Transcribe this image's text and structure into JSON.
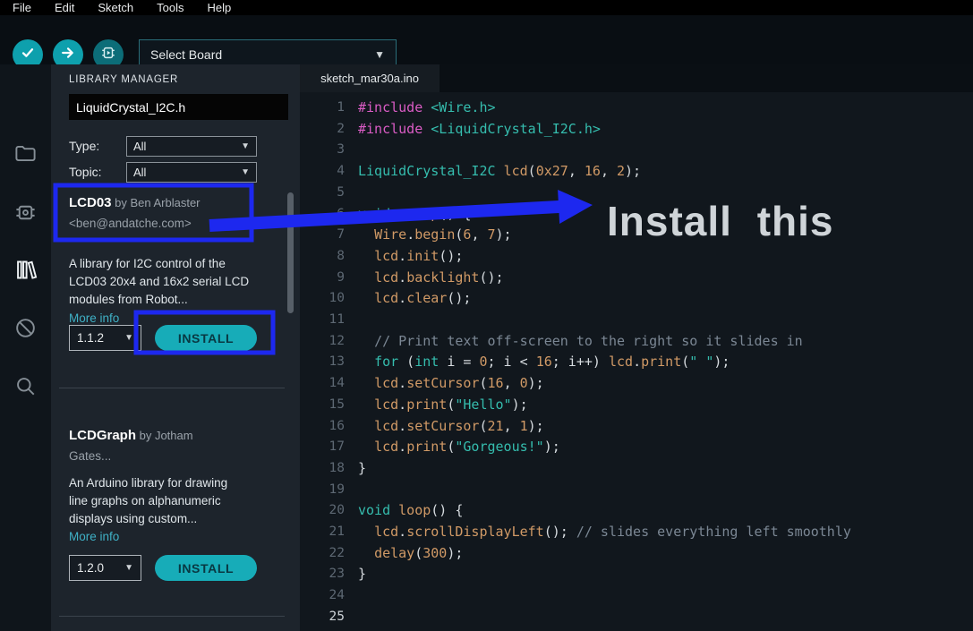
{
  "menu": {
    "items": [
      "File",
      "Edit",
      "Sketch",
      "Tools",
      "Help"
    ]
  },
  "toolbar": {
    "board_selector": "Select Board"
  },
  "activity": {
    "icons": [
      "sketchbook-folder",
      "boards-manager",
      "library-manager",
      "debug",
      "search"
    ]
  },
  "library_manager": {
    "title": "LIBRARY MANAGER",
    "search_value": "LiquidCrystal_I2C.h",
    "type_label": "Type:",
    "type_value": "All",
    "topic_label": "Topic:",
    "topic_value": "All",
    "items": [
      {
        "name": "LCD03",
        "by": " by Ben Arblaster",
        "author_line2": "<ben@andatche.com>",
        "description": [
          "A library for I2C control of the",
          "LCD03 20x4 and 16x2 serial LCD",
          "modules from Robot..."
        ],
        "more_info": "More info",
        "version": "1.1.2",
        "install_label": "INSTALL"
      },
      {
        "name": "LCDGraph",
        "by": " by Jotham",
        "author_line2": "Gates...",
        "description": [
          "An Arduino library for drawing",
          "line graphs on alphanumeric",
          "displays using custom..."
        ],
        "more_info": "More info",
        "version": "1.2.0",
        "install_label": "INSTALL"
      }
    ]
  },
  "editor": {
    "tab": "sketch_mar30a.ino",
    "active_line": 25,
    "lines": [
      [
        [
          "pre",
          "#include"
        ],
        [
          "pln",
          " "
        ],
        [
          "inc",
          "<Wire.h>"
        ]
      ],
      [
        [
          "pre",
          "#include"
        ],
        [
          "pln",
          " "
        ],
        [
          "inc",
          "<LiquidCrystal_I2C.h>"
        ]
      ],
      [],
      [
        [
          "typ",
          "LiquidCrystal_I2C"
        ],
        [
          "pln",
          " "
        ],
        [
          "id",
          "lcd"
        ],
        [
          "pln",
          "("
        ],
        [
          "num",
          "0x27"
        ],
        [
          "pln",
          ", "
        ],
        [
          "num",
          "16"
        ],
        [
          "pln",
          ", "
        ],
        [
          "num",
          "2"
        ],
        [
          "pln",
          ");"
        ]
      ],
      [],
      [
        [
          "kw",
          "void"
        ],
        [
          "pln",
          " "
        ],
        [
          "id",
          "setup"
        ],
        [
          "pln",
          "() {"
        ]
      ],
      [
        [
          "pln",
          "  "
        ],
        [
          "id",
          "Wire"
        ],
        [
          "pln",
          "."
        ],
        [
          "id",
          "begin"
        ],
        [
          "pln",
          "("
        ],
        [
          "num",
          "6"
        ],
        [
          "pln",
          ", "
        ],
        [
          "num",
          "7"
        ],
        [
          "pln",
          ");"
        ]
      ],
      [
        [
          "pln",
          "  "
        ],
        [
          "id",
          "lcd"
        ],
        [
          "pln",
          "."
        ],
        [
          "id",
          "init"
        ],
        [
          "pln",
          "();"
        ]
      ],
      [
        [
          "pln",
          "  "
        ],
        [
          "id",
          "lcd"
        ],
        [
          "pln",
          "."
        ],
        [
          "id",
          "backlight"
        ],
        [
          "pln",
          "();"
        ]
      ],
      [
        [
          "pln",
          "  "
        ],
        [
          "id",
          "lcd"
        ],
        [
          "pln",
          "."
        ],
        [
          "id",
          "clear"
        ],
        [
          "pln",
          "();"
        ]
      ],
      [],
      [
        [
          "pln",
          "  "
        ],
        [
          "com",
          "// Print text off-screen to the right so it slides in"
        ]
      ],
      [
        [
          "pln",
          "  "
        ],
        [
          "kw",
          "for"
        ],
        [
          "pln",
          " ("
        ],
        [
          "kw",
          "int"
        ],
        [
          "pln",
          " i = "
        ],
        [
          "num",
          "0"
        ],
        [
          "pln",
          "; i < "
        ],
        [
          "num",
          "16"
        ],
        [
          "pln",
          "; i++) "
        ],
        [
          "id",
          "lcd"
        ],
        [
          "pln",
          "."
        ],
        [
          "id",
          "print"
        ],
        [
          "pln",
          "("
        ],
        [
          "str",
          "\" \""
        ],
        [
          "pln",
          ");"
        ]
      ],
      [
        [
          "pln",
          "  "
        ],
        [
          "id",
          "lcd"
        ],
        [
          "pln",
          "."
        ],
        [
          "id",
          "setCursor"
        ],
        [
          "pln",
          "("
        ],
        [
          "num",
          "16"
        ],
        [
          "pln",
          ", "
        ],
        [
          "num",
          "0"
        ],
        [
          "pln",
          ");"
        ]
      ],
      [
        [
          "pln",
          "  "
        ],
        [
          "id",
          "lcd"
        ],
        [
          "pln",
          "."
        ],
        [
          "id",
          "print"
        ],
        [
          "pln",
          "("
        ],
        [
          "str",
          "\"Hello\""
        ],
        [
          "pln",
          ");"
        ]
      ],
      [
        [
          "pln",
          "  "
        ],
        [
          "id",
          "lcd"
        ],
        [
          "pln",
          "."
        ],
        [
          "id",
          "setCursor"
        ],
        [
          "pln",
          "("
        ],
        [
          "num",
          "21"
        ],
        [
          "pln",
          ", "
        ],
        [
          "num",
          "1"
        ],
        [
          "pln",
          ");"
        ]
      ],
      [
        [
          "pln",
          "  "
        ],
        [
          "id",
          "lcd"
        ],
        [
          "pln",
          "."
        ],
        [
          "id",
          "print"
        ],
        [
          "pln",
          "("
        ],
        [
          "str",
          "\"Gorgeous!\""
        ],
        [
          "pln",
          ");"
        ]
      ],
      [
        [
          "pln",
          "}"
        ]
      ],
      [],
      [
        [
          "kw",
          "void"
        ],
        [
          "pln",
          " "
        ],
        [
          "id",
          "loop"
        ],
        [
          "pln",
          "() {"
        ]
      ],
      [
        [
          "pln",
          "  "
        ],
        [
          "id",
          "lcd"
        ],
        [
          "pln",
          "."
        ],
        [
          "id",
          "scrollDisplayLeft"
        ],
        [
          "pln",
          "(); "
        ],
        [
          "com",
          "// slides everything left smoothly"
        ]
      ],
      [
        [
          "pln",
          "  "
        ],
        [
          "id",
          "delay"
        ],
        [
          "pln",
          "("
        ],
        [
          "num",
          "300"
        ],
        [
          "pln",
          ");"
        ]
      ],
      [
        [
          "pln",
          "}"
        ]
      ],
      [],
      []
    ]
  },
  "annotation": {
    "callout": "Install this"
  },
  "colors": {
    "accent_teal": "#0ea0ad",
    "install_button": "#17acb8",
    "annotation_blue": "#1d28ef",
    "link": "#3fb1c6"
  }
}
